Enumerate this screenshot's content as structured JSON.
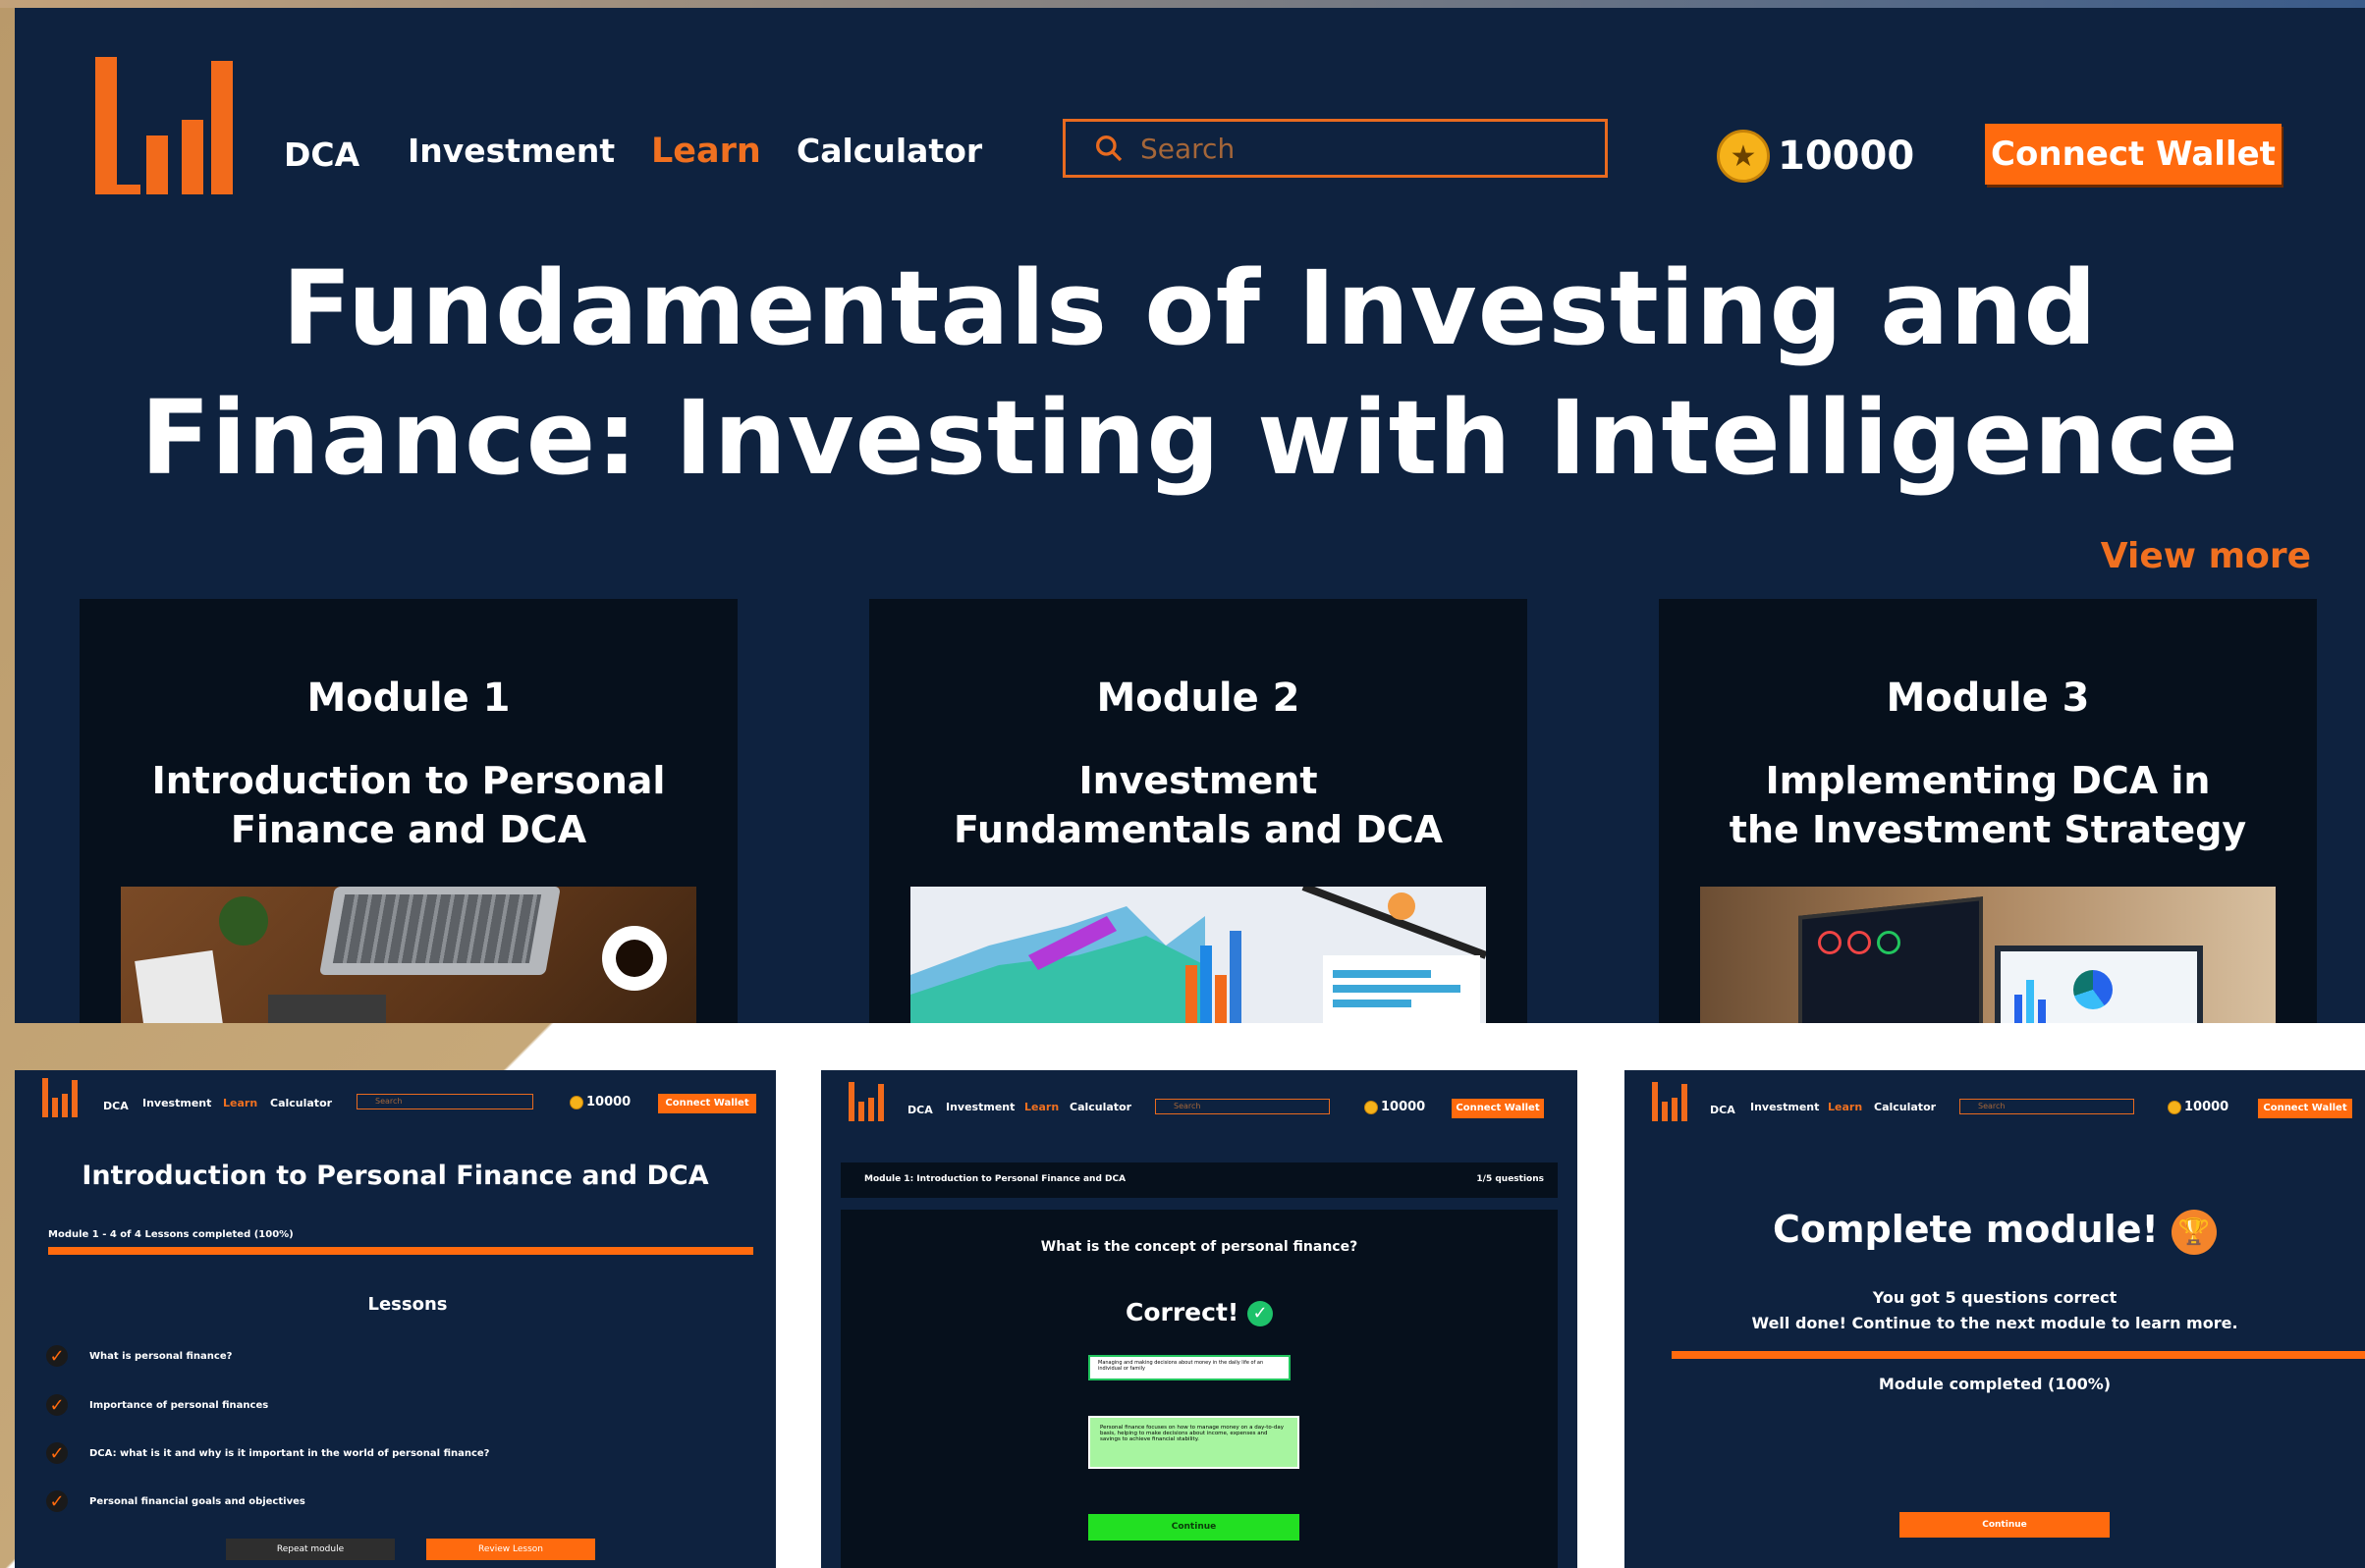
{
  "header": {
    "nav": [
      "DCA",
      "Investment",
      "Learn",
      "Calculator"
    ],
    "active_nav": "Learn",
    "search_placeholder": "Search",
    "coins": "10000",
    "wallet_label": "Connect Wallet"
  },
  "hero": {
    "title_line1": "Fundamentals of Investing and",
    "title_line2": "Finance: Investing with Intelligence",
    "view_more": "View more"
  },
  "modules": [
    {
      "title": "Module 1",
      "line1": "Introduction to Personal",
      "line2": "Finance and DCA",
      "image": "desk-laptop-coffee"
    },
    {
      "title": "Module 2",
      "line1": "Investment",
      "line2": "Fundamentals and DCA",
      "image": "printed-charts"
    },
    {
      "title": "Module 3",
      "line1": "Implementing DCA in",
      "line2": "the Investment Strategy",
      "image": "tablet-dashboard"
    }
  ],
  "lessons_screen": {
    "title": "Introduction to Personal Finance and DCA",
    "progress_text": "Module 1 - 4 of 4 Lessons completed (100%)",
    "progress": 1.0,
    "lessons_heading": "Lessons",
    "lessons": [
      "What is personal finance?",
      "Importance of personal finances",
      "DCA: what is it and why is it important in the world of personal finance?",
      "Personal financial goals and objectives"
    ],
    "repeat_label": "Repeat module",
    "review_label": "Review Lesson"
  },
  "quiz_screen": {
    "module_label": "Module 1: Introduction to Personal Finance and DCA",
    "count_label": "1/5 questions",
    "question": "What is the concept of personal finance?",
    "result": "Correct!",
    "answer1": "Managing and making decisions about money in the daily life of an individual or family",
    "answer2": "Personal finance focuses on how to manage money on a day-to-day basis, helping to make decisions about income, expenses and savings to achieve financial stability.",
    "continue_label": "Continue"
  },
  "complete_screen": {
    "title": "Complete module!",
    "line1": "You got 5 questions correct",
    "line2": "Well done! Continue to the next module to learn more.",
    "status": "Module completed (100%)",
    "progress": 1.0,
    "continue_label": "Continue"
  },
  "colors": {
    "bg": "#0e223f",
    "accent": "#ff6a0e",
    "card": "#06101c",
    "success": "#22e022"
  }
}
